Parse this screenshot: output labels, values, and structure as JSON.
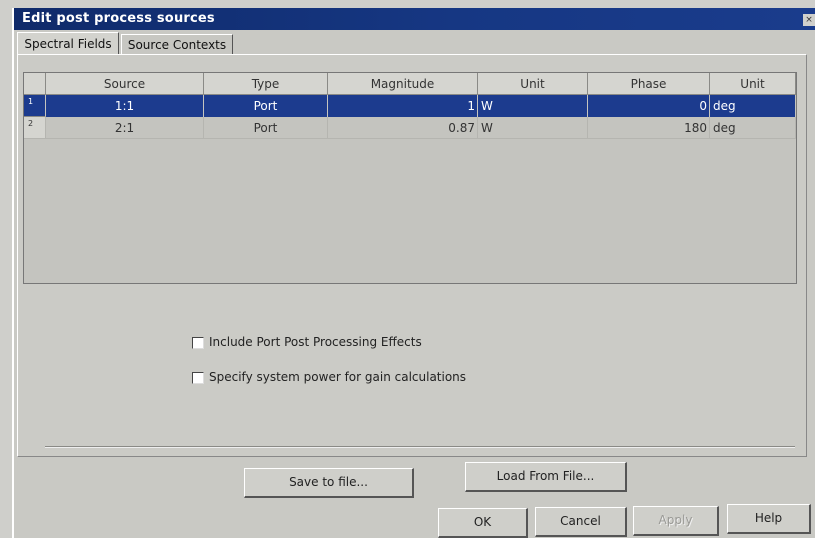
{
  "window": {
    "title": "Edit post process sources",
    "close_icon": "×"
  },
  "tabs": [
    {
      "label": "Spectral Fields",
      "active": true
    },
    {
      "label": "Source Contexts",
      "active": false
    }
  ],
  "table": {
    "headers": [
      "Source",
      "Type",
      "Magnitude",
      "Unit",
      "Phase",
      "Unit"
    ],
    "rows": [
      {
        "num": "1",
        "source": "1:1",
        "type": "Port",
        "magnitude": "1",
        "unit": "W",
        "phase": "0",
        "phase_unit": "deg",
        "selected": true
      },
      {
        "num": "2",
        "source": "2:1",
        "type": "Port",
        "magnitude": "0.87",
        "unit": "W",
        "phase": "180",
        "phase_unit": "deg",
        "selected": false
      }
    ]
  },
  "options": {
    "include_port_effects": {
      "label": "Include Port Post Processing Effects",
      "checked": false
    },
    "system_power": {
      "label": "Specify system power for gain calculations",
      "checked": false
    }
  },
  "file_buttons": {
    "save": "Save to file...",
    "load": "Load From File..."
  },
  "dialog_buttons": {
    "ok": "OK",
    "cancel": "Cancel",
    "apply": "Apply",
    "help": "Help"
  },
  "colors": {
    "titlebar": "#163783",
    "selection": "#1c3b8e"
  }
}
